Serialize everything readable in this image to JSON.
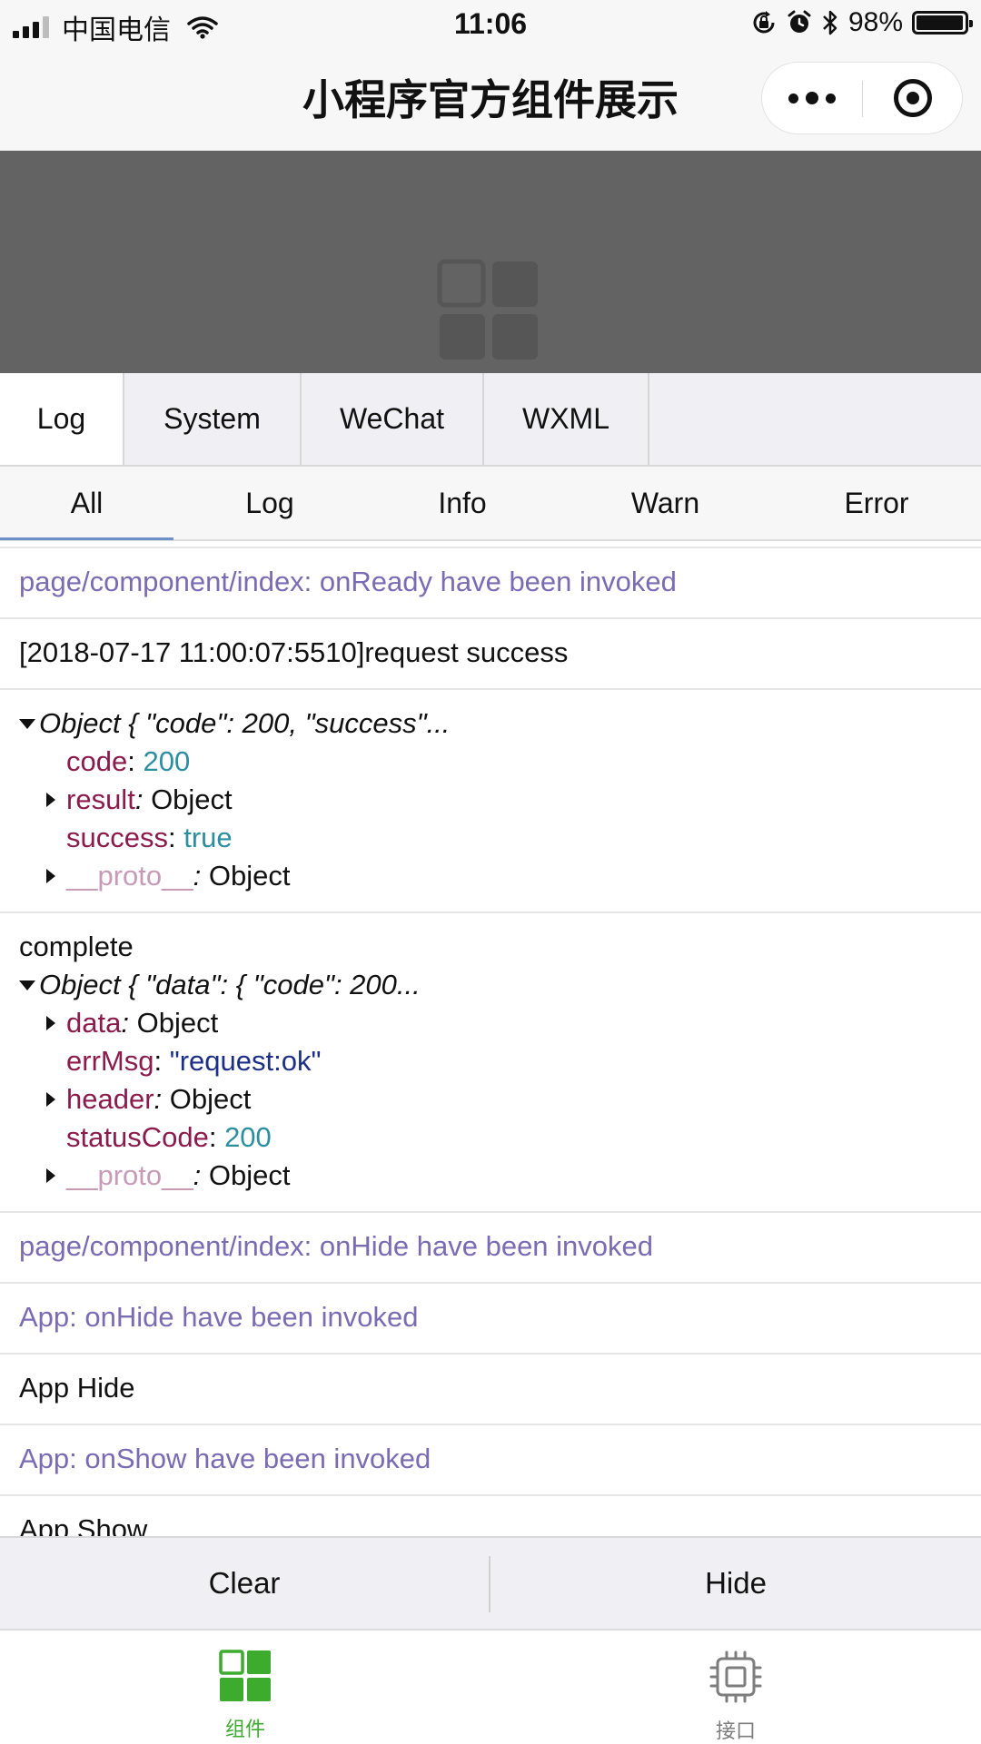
{
  "status_bar": {
    "carrier": "中国电信",
    "time": "11:06",
    "battery": "98%",
    "battery_level": 0.98,
    "icons": [
      "signal-icon",
      "wifi-icon",
      "rotation-lock-icon",
      "alarm-icon",
      "bluetooth-icon",
      "battery-icon"
    ]
  },
  "nav": {
    "title": "小程序官方组件展示",
    "icons": [
      "more-icon",
      "close-mini-program-icon"
    ]
  },
  "top_tabs": [
    "Log",
    "System",
    "WeChat",
    "WXML"
  ],
  "filter_tabs": [
    "All",
    "Log",
    "Info",
    "Warn",
    "Error"
  ],
  "colors": {
    "info_text": "#7a6bb3",
    "key": "#8b1a4d",
    "number": "#2b8ea1",
    "string": "#1c2f88",
    "proto": "#c79bb8",
    "active_tab": "#3cab2e",
    "filter_underline": "#6f8fc9",
    "preview_bg": "#636363"
  },
  "logs": {
    "l1": "page/component/index: onReady have been invoked",
    "l2": "[2018-07-17 11:00:07:5510]request success",
    "obj1": {
      "summary": "Object { \"code\": 200, \"success\"...",
      "code_key": "code",
      "code_val": "200",
      "result_key": "result",
      "result_val": "Object",
      "success_key": "success",
      "success_val": "true",
      "proto_key": "__proto__",
      "proto_val": "Object"
    },
    "l3": "complete",
    "obj2": {
      "summary": "Object { \"data\": { \"code\": 200...",
      "data_key": "data",
      "data_val": "Object",
      "errmsg_key": "errMsg",
      "errmsg_val": "\"request:ok\"",
      "header_key": "header",
      "header_val": "Object",
      "status_key": "statusCode",
      "status_val": "200",
      "proto_key": "__proto__",
      "proto_val": "Object"
    },
    "l4": "page/component/index: onHide have been invoked",
    "l5": "App: onHide have been invoked",
    "l6": "App Hide",
    "l7": "App: onShow have been invoked",
    "l8": "App Show"
  },
  "actions": {
    "clear": "Clear",
    "hide": "Hide"
  },
  "tabbar": {
    "components": "组件",
    "api": "接口",
    "icons": [
      "components-grid-icon",
      "api-chip-icon"
    ]
  }
}
